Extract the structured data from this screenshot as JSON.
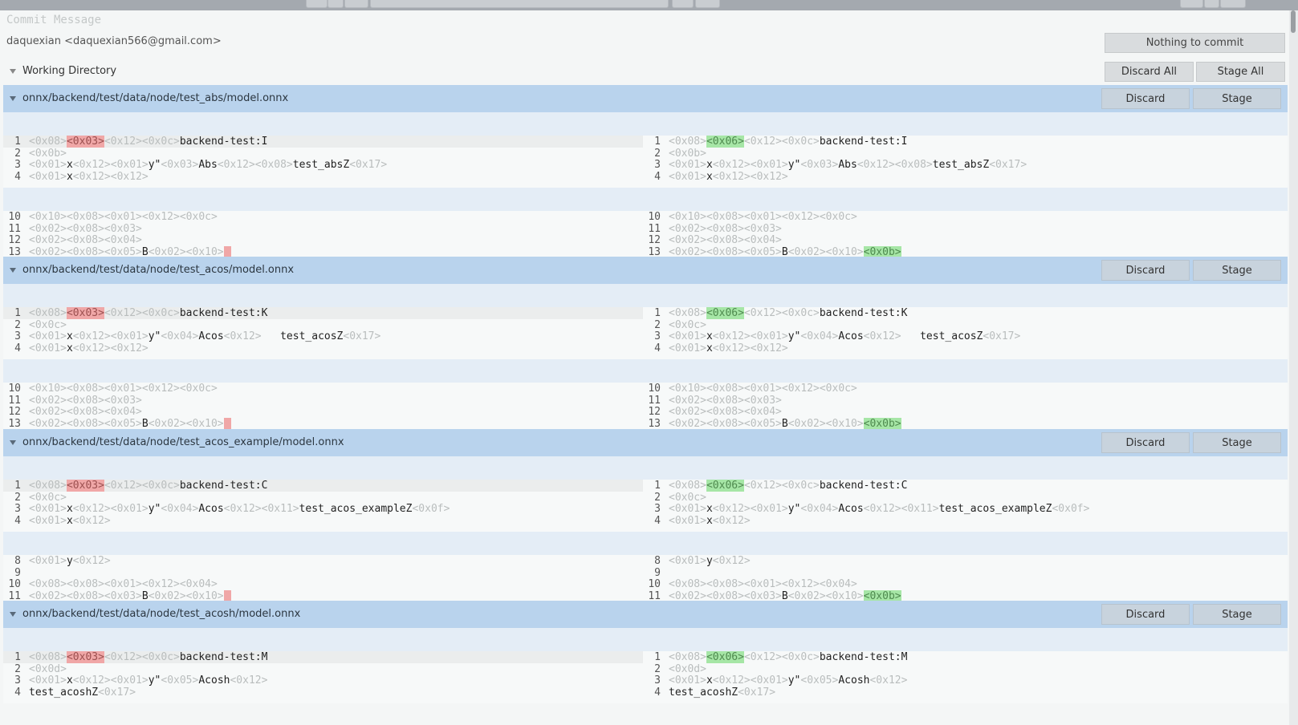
{
  "commit": {
    "placeholder": "Commit Message",
    "author": "daquexian <daquexian566@gmail.com>",
    "commit_button": "Nothing to commit"
  },
  "working_directory": {
    "label": "Working Directory",
    "discard_all": "Discard All",
    "stage_all": "Stage All"
  },
  "file_actions": {
    "discard": "Discard",
    "stage": "Stage"
  },
  "files": [
    {
      "path": "onnx/backend/test/data/node/test_abs/model.onnx",
      "hunks": [
        [
          {
            "ln": "1",
            "l": [
              [
                "c",
                "<0x08>"
              ],
              [
                "del",
                "<0x03>"
              ],
              [
                "c",
                "<0x12><0x0c>"
              ],
              [
                "t",
                "backend-test:I"
              ]
            ],
            "r": [
              [
                "c",
                "<0x08>"
              ],
              [
                "add",
                "<0x06>"
              ],
              [
                "c",
                "<0x12><0x0c>"
              ],
              [
                "t",
                "backend-test:I"
              ]
            ]
          },
          {
            "ln": "2",
            "l": [
              [
                "c",
                "<0x0b>"
              ]
            ],
            "r": [
              [
                "c",
                "<0x0b>"
              ]
            ]
          },
          {
            "ln": "3",
            "l": [
              [
                "c",
                "<0x01>"
              ],
              [
                "t",
                "x"
              ],
              [
                "c",
                "<0x12><0x01>"
              ],
              [
                "t",
                "y\""
              ],
              [
                "c",
                "<0x03>"
              ],
              [
                "t",
                "Abs"
              ],
              [
                "c",
                "<0x12><0x08>"
              ],
              [
                "t",
                "test_absZ"
              ],
              [
                "c",
                "<0x17>"
              ]
            ],
            "r": [
              [
                "c",
                "<0x01>"
              ],
              [
                "t",
                "x"
              ],
              [
                "c",
                "<0x12><0x01>"
              ],
              [
                "t",
                "y\""
              ],
              [
                "c",
                "<0x03>"
              ],
              [
                "t",
                "Abs"
              ],
              [
                "c",
                "<0x12><0x08>"
              ],
              [
                "t",
                "test_absZ"
              ],
              [
                "c",
                "<0x17>"
              ]
            ]
          },
          {
            "ln": "4",
            "l": [
              [
                "c",
                "<0x01>"
              ],
              [
                "t",
                "x"
              ],
              [
                "c",
                "<0x12><0x12>"
              ]
            ],
            "r": [
              [
                "c",
                "<0x01>"
              ],
              [
                "t",
                "x"
              ],
              [
                "c",
                "<0x12><0x12>"
              ]
            ]
          }
        ],
        [
          {
            "ln": "10",
            "l": [
              [
                "c",
                "<0x10><0x08><0x01><0x12><0x0c>"
              ]
            ],
            "r": [
              [
                "c",
                "<0x10><0x08><0x01><0x12><0x0c>"
              ]
            ]
          },
          {
            "ln": "11",
            "l": [
              [
                "c",
                "<0x02><0x08><0x03>"
              ]
            ],
            "r": [
              [
                "c",
                "<0x02><0x08><0x03>"
              ]
            ]
          },
          {
            "ln": "12",
            "l": [
              [
                "c",
                "<0x02><0x08><0x04>"
              ]
            ],
            "r": [
              [
                "c",
                "<0x02><0x08><0x04>"
              ]
            ]
          },
          {
            "ln": "13",
            "l": [
              [
                "c",
                "<0x02><0x08><0x05>"
              ],
              [
                "t",
                "B"
              ],
              [
                "c",
                "<0x02><0x10>"
              ],
              [
                "cur",
                ""
              ]
            ],
            "r": [
              [
                "c",
                "<0x02><0x08><0x05>"
              ],
              [
                "t",
                "B"
              ],
              [
                "c",
                "<0x02><0x10>"
              ],
              [
                "add",
                "<0x0b>"
              ]
            ]
          }
        ]
      ]
    },
    {
      "path": "onnx/backend/test/data/node/test_acos/model.onnx",
      "hunks": [
        [
          {
            "ln": "1",
            "l": [
              [
                "c",
                "<0x08>"
              ],
              [
                "del",
                "<0x03>"
              ],
              [
                "c",
                "<0x12><0x0c>"
              ],
              [
                "t",
                "backend-test:K"
              ]
            ],
            "r": [
              [
                "c",
                "<0x08>"
              ],
              [
                "add",
                "<0x06>"
              ],
              [
                "c",
                "<0x12><0x0c>"
              ],
              [
                "t",
                "backend-test:K"
              ]
            ]
          },
          {
            "ln": "2",
            "l": [
              [
                "c",
                "<0x0c>"
              ]
            ],
            "r": [
              [
                "c",
                "<0x0c>"
              ]
            ]
          },
          {
            "ln": "3",
            "l": [
              [
                "c",
                "<0x01>"
              ],
              [
                "t",
                "x"
              ],
              [
                "c",
                "<0x12><0x01>"
              ],
              [
                "t",
                "y\""
              ],
              [
                "c",
                "<0x04>"
              ],
              [
                "t",
                "Acos"
              ],
              [
                "c",
                "<0x12>"
              ],
              [
                "t",
                "   test_acosZ"
              ],
              [
                "c",
                "<0x17>"
              ]
            ],
            "r": [
              [
                "c",
                "<0x01>"
              ],
              [
                "t",
                "x"
              ],
              [
                "c",
                "<0x12><0x01>"
              ],
              [
                "t",
                "y\""
              ],
              [
                "c",
                "<0x04>"
              ],
              [
                "t",
                "Acos"
              ],
              [
                "c",
                "<0x12>"
              ],
              [
                "t",
                "   test_acosZ"
              ],
              [
                "c",
                "<0x17>"
              ]
            ]
          },
          {
            "ln": "4",
            "l": [
              [
                "c",
                "<0x01>"
              ],
              [
                "t",
                "x"
              ],
              [
                "c",
                "<0x12><0x12>"
              ]
            ],
            "r": [
              [
                "c",
                "<0x01>"
              ],
              [
                "t",
                "x"
              ],
              [
                "c",
                "<0x12><0x12>"
              ]
            ]
          }
        ],
        [
          {
            "ln": "10",
            "l": [
              [
                "c",
                "<0x10><0x08><0x01><0x12><0x0c>"
              ]
            ],
            "r": [
              [
                "c",
                "<0x10><0x08><0x01><0x12><0x0c>"
              ]
            ]
          },
          {
            "ln": "11",
            "l": [
              [
                "c",
                "<0x02><0x08><0x03>"
              ]
            ],
            "r": [
              [
                "c",
                "<0x02><0x08><0x03>"
              ]
            ]
          },
          {
            "ln": "12",
            "l": [
              [
                "c",
                "<0x02><0x08><0x04>"
              ]
            ],
            "r": [
              [
                "c",
                "<0x02><0x08><0x04>"
              ]
            ]
          },
          {
            "ln": "13",
            "l": [
              [
                "c",
                "<0x02><0x08><0x05>"
              ],
              [
                "t",
                "B"
              ],
              [
                "c",
                "<0x02><0x10>"
              ],
              [
                "cur",
                ""
              ]
            ],
            "r": [
              [
                "c",
                "<0x02><0x08><0x05>"
              ],
              [
                "t",
                "B"
              ],
              [
                "c",
                "<0x02><0x10>"
              ],
              [
                "add",
                "<0x0b>"
              ]
            ]
          }
        ]
      ]
    },
    {
      "path": "onnx/backend/test/data/node/test_acos_example/model.onnx",
      "hunks": [
        [
          {
            "ln": "1",
            "l": [
              [
                "c",
                "<0x08>"
              ],
              [
                "del",
                "<0x03>"
              ],
              [
                "c",
                "<0x12><0x0c>"
              ],
              [
                "t",
                "backend-test:C"
              ]
            ],
            "r": [
              [
                "c",
                "<0x08>"
              ],
              [
                "add",
                "<0x06>"
              ],
              [
                "c",
                "<0x12><0x0c>"
              ],
              [
                "t",
                "backend-test:C"
              ]
            ]
          },
          {
            "ln": "2",
            "l": [
              [
                "c",
                "<0x0c>"
              ]
            ],
            "r": [
              [
                "c",
                "<0x0c>"
              ]
            ]
          },
          {
            "ln": "3",
            "l": [
              [
                "c",
                "<0x01>"
              ],
              [
                "t",
                "x"
              ],
              [
                "c",
                "<0x12><0x01>"
              ],
              [
                "t",
                "y\""
              ],
              [
                "c",
                "<0x04>"
              ],
              [
                "t",
                "Acos"
              ],
              [
                "c",
                "<0x12><0x11>"
              ],
              [
                "t",
                "test_acos_exampleZ"
              ],
              [
                "c",
                "<0x0f>"
              ]
            ],
            "r": [
              [
                "c",
                "<0x01>"
              ],
              [
                "t",
                "x"
              ],
              [
                "c",
                "<0x12><0x01>"
              ],
              [
                "t",
                "y\""
              ],
              [
                "c",
                "<0x04>"
              ],
              [
                "t",
                "Acos"
              ],
              [
                "c",
                "<0x12><0x11>"
              ],
              [
                "t",
                "test_acos_exampleZ"
              ],
              [
                "c",
                "<0x0f>"
              ]
            ]
          },
          {
            "ln": "4",
            "l": [
              [
                "c",
                "<0x01>"
              ],
              [
                "t",
                "x"
              ],
              [
                "c",
                "<0x12>"
              ]
            ],
            "r": [
              [
                "c",
                "<0x01>"
              ],
              [
                "t",
                "x"
              ],
              [
                "c",
                "<0x12>"
              ]
            ]
          }
        ],
        [
          {
            "ln": "8",
            "l": [
              [
                "c",
                "<0x01>"
              ],
              [
                "t",
                "y"
              ],
              [
                "c",
                "<0x12>"
              ]
            ],
            "r": [
              [
                "c",
                "<0x01>"
              ],
              [
                "t",
                "y"
              ],
              [
                "c",
                "<0x12>"
              ]
            ]
          },
          {
            "ln": "9",
            "l": [],
            "r": []
          },
          {
            "ln": "10",
            "l": [
              [
                "c",
                "<0x08><0x08><0x01><0x12><0x04>"
              ]
            ],
            "r": [
              [
                "c",
                "<0x08><0x08><0x01><0x12><0x04>"
              ]
            ]
          },
          {
            "ln": "11",
            "l": [
              [
                "c",
                "<0x02><0x08><0x03>"
              ],
              [
                "t",
                "B"
              ],
              [
                "c",
                "<0x02><0x10>"
              ],
              [
                "cur",
                ""
              ]
            ],
            "r": [
              [
                "c",
                "<0x02><0x08><0x03>"
              ],
              [
                "t",
                "B"
              ],
              [
                "c",
                "<0x02><0x10>"
              ],
              [
                "add",
                "<0x0b>"
              ]
            ]
          }
        ]
      ]
    },
    {
      "path": "onnx/backend/test/data/node/test_acosh/model.onnx",
      "hunks": [
        [
          {
            "ln": "1",
            "l": [
              [
                "c",
                "<0x08>"
              ],
              [
                "del",
                "<0x03>"
              ],
              [
                "c",
                "<0x12><0x0c>"
              ],
              [
                "t",
                "backend-test:M"
              ]
            ],
            "r": [
              [
                "c",
                "<0x08>"
              ],
              [
                "add",
                "<0x06>"
              ],
              [
                "c",
                "<0x12><0x0c>"
              ],
              [
                "t",
                "backend-test:M"
              ]
            ]
          },
          {
            "ln": "2",
            "l": [
              [
                "c",
                "<0x0d>"
              ]
            ],
            "r": [
              [
                "c",
                "<0x0d>"
              ]
            ]
          },
          {
            "ln": "3",
            "l": [
              [
                "c",
                "<0x01>"
              ],
              [
                "t",
                "x"
              ],
              [
                "c",
                "<0x12><0x01>"
              ],
              [
                "t",
                "y\""
              ],
              [
                "c",
                "<0x05>"
              ],
              [
                "t",
                "Acosh"
              ],
              [
                "c",
                "<0x12>"
              ]
            ],
            "r": [
              [
                "c",
                "<0x01>"
              ],
              [
                "t",
                "x"
              ],
              [
                "c",
                "<0x12><0x01>"
              ],
              [
                "t",
                "y\""
              ],
              [
                "c",
                "<0x05>"
              ],
              [
                "t",
                "Acosh"
              ],
              [
                "c",
                "<0x12>"
              ]
            ]
          },
          {
            "ln": "4",
            "l": [
              [
                "t",
                "test_acoshZ"
              ],
              [
                "c",
                "<0x17>"
              ]
            ],
            "r": [
              [
                "t",
                "test_acoshZ"
              ],
              [
                "c",
                "<0x17>"
              ]
            ]
          }
        ]
      ]
    }
  ]
}
